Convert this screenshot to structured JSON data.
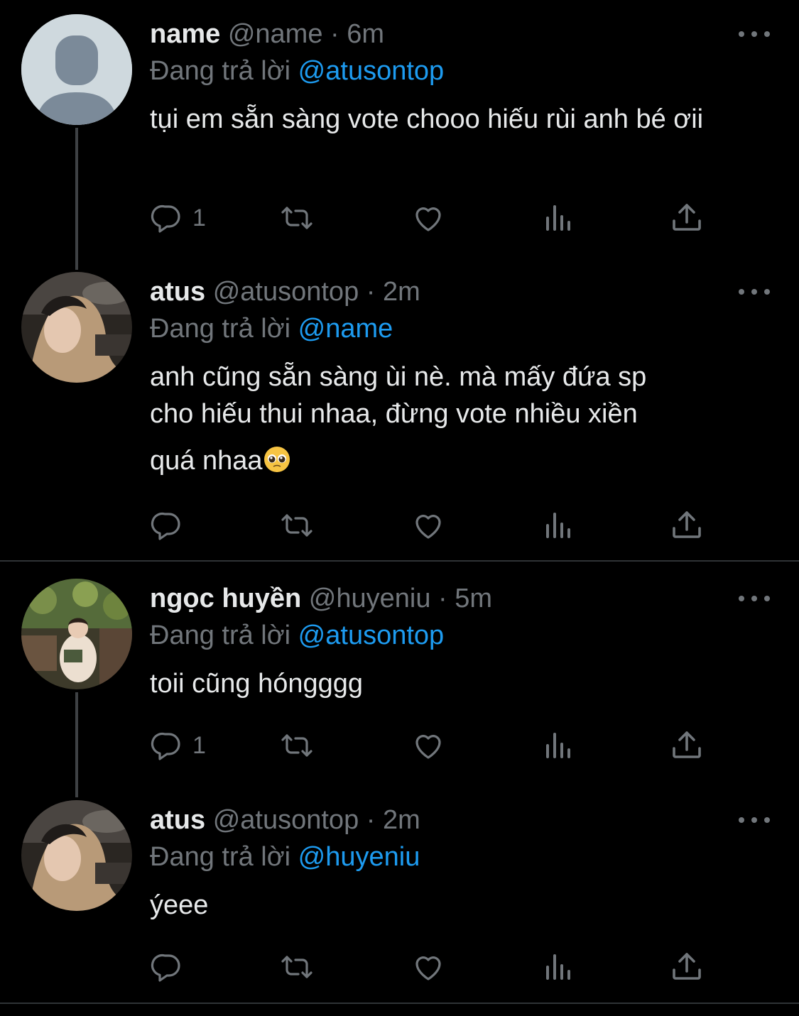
{
  "tweets": [
    {
      "name": "name",
      "handle": "@name",
      "time": "6m",
      "reply_prefix": "Đang trả lời",
      "reply_to": "@atusontop",
      "text": "tụi em sẵn sàng vote chooo hiếu rùi anh bé ơii",
      "reply_count": "1",
      "avatar": "default-avatar"
    },
    {
      "name": "atus",
      "handle": "@atusontop",
      "time": "2m",
      "reply_prefix": "Đang trả lời",
      "reply_to": "@name",
      "text_lines": [
        "anh cũng sẵn sàng ùi nè. mà mấy đứa sp",
        "cho hiếu thui nhaa, đừng vote nhiều xiền",
        "quá nhaa"
      ],
      "emoji": "pleading-face",
      "reply_count": "",
      "avatar": "photo-avatar"
    },
    {
      "name": "ngọc huyền",
      "handle": "@huyeniu",
      "time": "5m",
      "reply_prefix": "Đang trả lời",
      "reply_to": "@atusontop",
      "text": "toii cũng hóngggg",
      "reply_count": "1",
      "avatar": "photo-avatar"
    },
    {
      "name": "atus",
      "handle": "@atusontop",
      "time": "2m",
      "reply_prefix": "Đang trả lời",
      "reply_to": "@huyeniu",
      "text": "ýeee",
      "reply_count": "",
      "avatar": "photo-avatar"
    }
  ],
  "separator": "·",
  "colors": {
    "background": "#000000",
    "text": "#e7e9ea",
    "muted": "#71767b",
    "link": "#1d9bf0",
    "thread_line": "#3e4144"
  },
  "icons": [
    "reply-icon",
    "retweet-icon",
    "like-icon",
    "analytics-icon",
    "share-icon",
    "more-icon"
  ]
}
